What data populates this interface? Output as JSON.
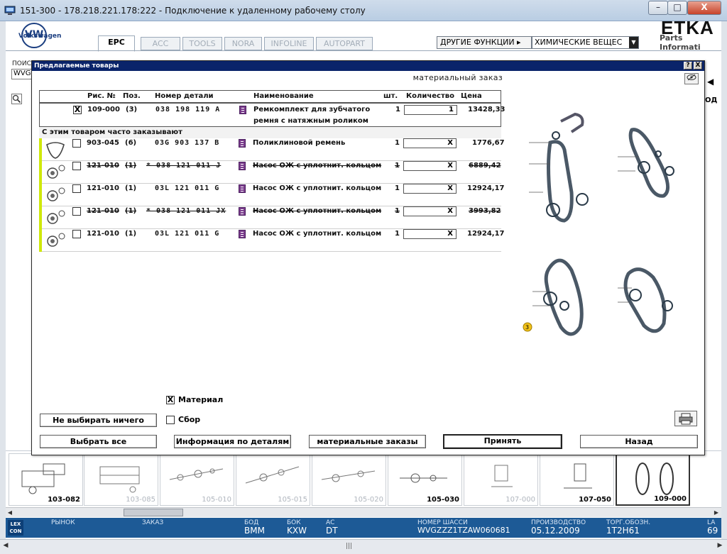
{
  "window": {
    "title": "151-300 - 178.218.221.178:222 - Подключение к удаленному рабочему столу",
    "min_label": "–",
    "max_label": "□",
    "close_label": "X"
  },
  "app": {
    "brand_text": "Volkswagen",
    "logo_letters": "VW",
    "etka_logo": "ETKA",
    "etka_sub": "Parts Informati",
    "tabs": [
      {
        "label": "EPC",
        "active": true
      },
      {
        "label": "ACC",
        "active": false
      },
      {
        "label": "TOOLS",
        "active": false
      },
      {
        "label": "NORA",
        "active": false
      },
      {
        "label": "INFOLINE",
        "active": false
      },
      {
        "label": "AUTOPART",
        "active": false
      }
    ],
    "other_functions_label": "ДРУГИЕ ФУНКЦИИ ▸",
    "other_functions_value": "ХИМИЧЕСКИЕ ВЕЩЕС",
    "search_label": "ПОИС",
    "search_value": "WVG",
    "right_partial": "ОД"
  },
  "thumbnails": [
    {
      "label": "103-082",
      "dark": true
    },
    {
      "label": "103-085",
      "dark": false
    },
    {
      "label": "105-010",
      "dark": false
    },
    {
      "label": "105-015",
      "dark": false
    },
    {
      "label": "105-020",
      "dark": false
    },
    {
      "label": "105-030",
      "dark": true
    },
    {
      "label": "107-000",
      "dark": false
    },
    {
      "label": "107-050",
      "dark": true
    },
    {
      "label": "109-000",
      "dark": true,
      "selected": true
    }
  ],
  "statusbar": {
    "logo": "LEX CON",
    "market_label": "РЫНОК",
    "order_label": "ЗАКАЗ",
    "bod_label": "БОД",
    "bod_value": "BMM",
    "bok_label": "БОК",
    "bok_value": "KXW",
    "ac_label": "АС",
    "ac_value": "DT",
    "chassis_label": "НОМЕР ШАССИ",
    "chassis_value": "WVGZZZ1TZAW060681",
    "production_label": "ПРОИЗВОДСТВО",
    "production_value": "05.12.2009",
    "trade_label": "ТОРГ.ОБОЗН.",
    "trade_value": "1T2H61",
    "la_label": "LA",
    "la_value": "69"
  },
  "dialog": {
    "title": "Предлагаемые товары",
    "help_label": "?",
    "close_label": "X",
    "subtitle": "материальный заказ",
    "columns": {
      "fig": "Рис. №",
      "pos": "Поз.",
      "part": "Номер детали",
      "name": "Наименование",
      "pcs": "шт.",
      "qty": "Количество",
      "price": "Цена"
    },
    "main_item": {
      "checked": "X",
      "fig": "109-000",
      "pos": "(3)",
      "part": "038 198 119 A",
      "name_line1": "Ремкомплект для зубчатого",
      "name_line2": "ремня с натяжным роликом",
      "pcs": "1",
      "qty": "1",
      "price": "13428,33"
    },
    "related_label": "С этим товаром часто заказывают",
    "related": [
      {
        "fig": "903-045",
        "pos": "(6)",
        "part": "03G 903 137 B",
        "name": "Поликлиновой ремень",
        "pcs": "1",
        "qty": "X",
        "price": "1776,67",
        "struck": false
      },
      {
        "fig": "121-010",
        "pos": "(1)",
        "part": "* 038 121 011 J",
        "name": "Насос ОЖ с уплотнит. кольцом",
        "pcs": "1",
        "qty": "X",
        "price": "6889,42",
        "struck": true
      },
      {
        "fig": "121-010",
        "pos": "(1)",
        "part": "03L 121 011 G",
        "name": "Насос ОЖ с уплотнит. кольцом",
        "pcs": "1",
        "qty": "X",
        "price": "12924,17",
        "struck": false
      },
      {
        "fig": "121-010",
        "pos": "(1)",
        "part": "* 038 121 011 JX",
        "name": "Насос ОЖ с уплотнит. кольцом",
        "pcs": "1",
        "qty": "X",
        "price": "3993,82",
        "struck": true
      },
      {
        "fig": "121-010",
        "pos": "(1)",
        "part": "03L 121 011 G",
        "name": "Насос ОЖ с уплотнит. кольцом",
        "pcs": "1",
        "qty": "X",
        "price": "12924,17",
        "struck": false
      }
    ],
    "diagram_marker": "3",
    "material_checkbox": {
      "checked": "X",
      "label": "Материал"
    },
    "assembly_checkbox": {
      "checked": "",
      "label": "Сбор"
    },
    "buttons": {
      "select_none": "Не выбирать ничего",
      "select_all": "Выбрать все",
      "part_info": "Информация по деталям",
      "material_orders": "материальные заказы",
      "accept": "Принять",
      "back": "Назад"
    }
  }
}
